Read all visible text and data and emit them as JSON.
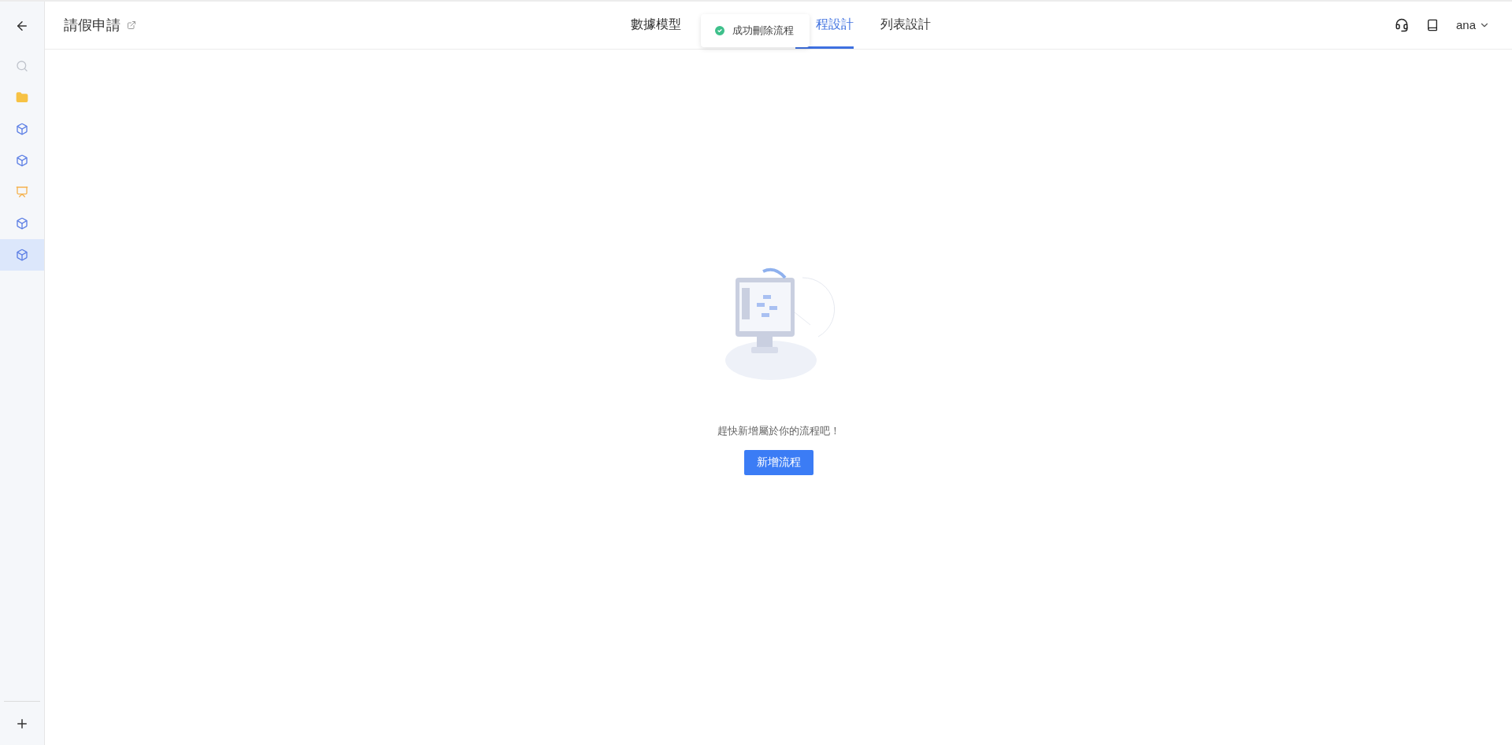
{
  "header": {
    "title": "請假申請",
    "tabs": [
      {
        "label": "數據模型",
        "selected": false
      },
      {
        "label": "程設計",
        "selected": true
      },
      {
        "label": "列表設計",
        "selected": false
      }
    ],
    "user": "ana"
  },
  "toast": {
    "message": "成功刪除流程"
  },
  "sidebar": {
    "items": [
      {
        "kind": "search",
        "selected": false
      },
      {
        "kind": "folder",
        "selected": false
      },
      {
        "kind": "cube",
        "selected": false
      },
      {
        "kind": "cube",
        "selected": false
      },
      {
        "kind": "chart",
        "selected": false
      },
      {
        "kind": "cube",
        "selected": false
      },
      {
        "kind": "cube",
        "selected": true
      }
    ]
  },
  "empty_state": {
    "message": "趕快新增屬於你的流程吧！",
    "button": "新增流程"
  }
}
